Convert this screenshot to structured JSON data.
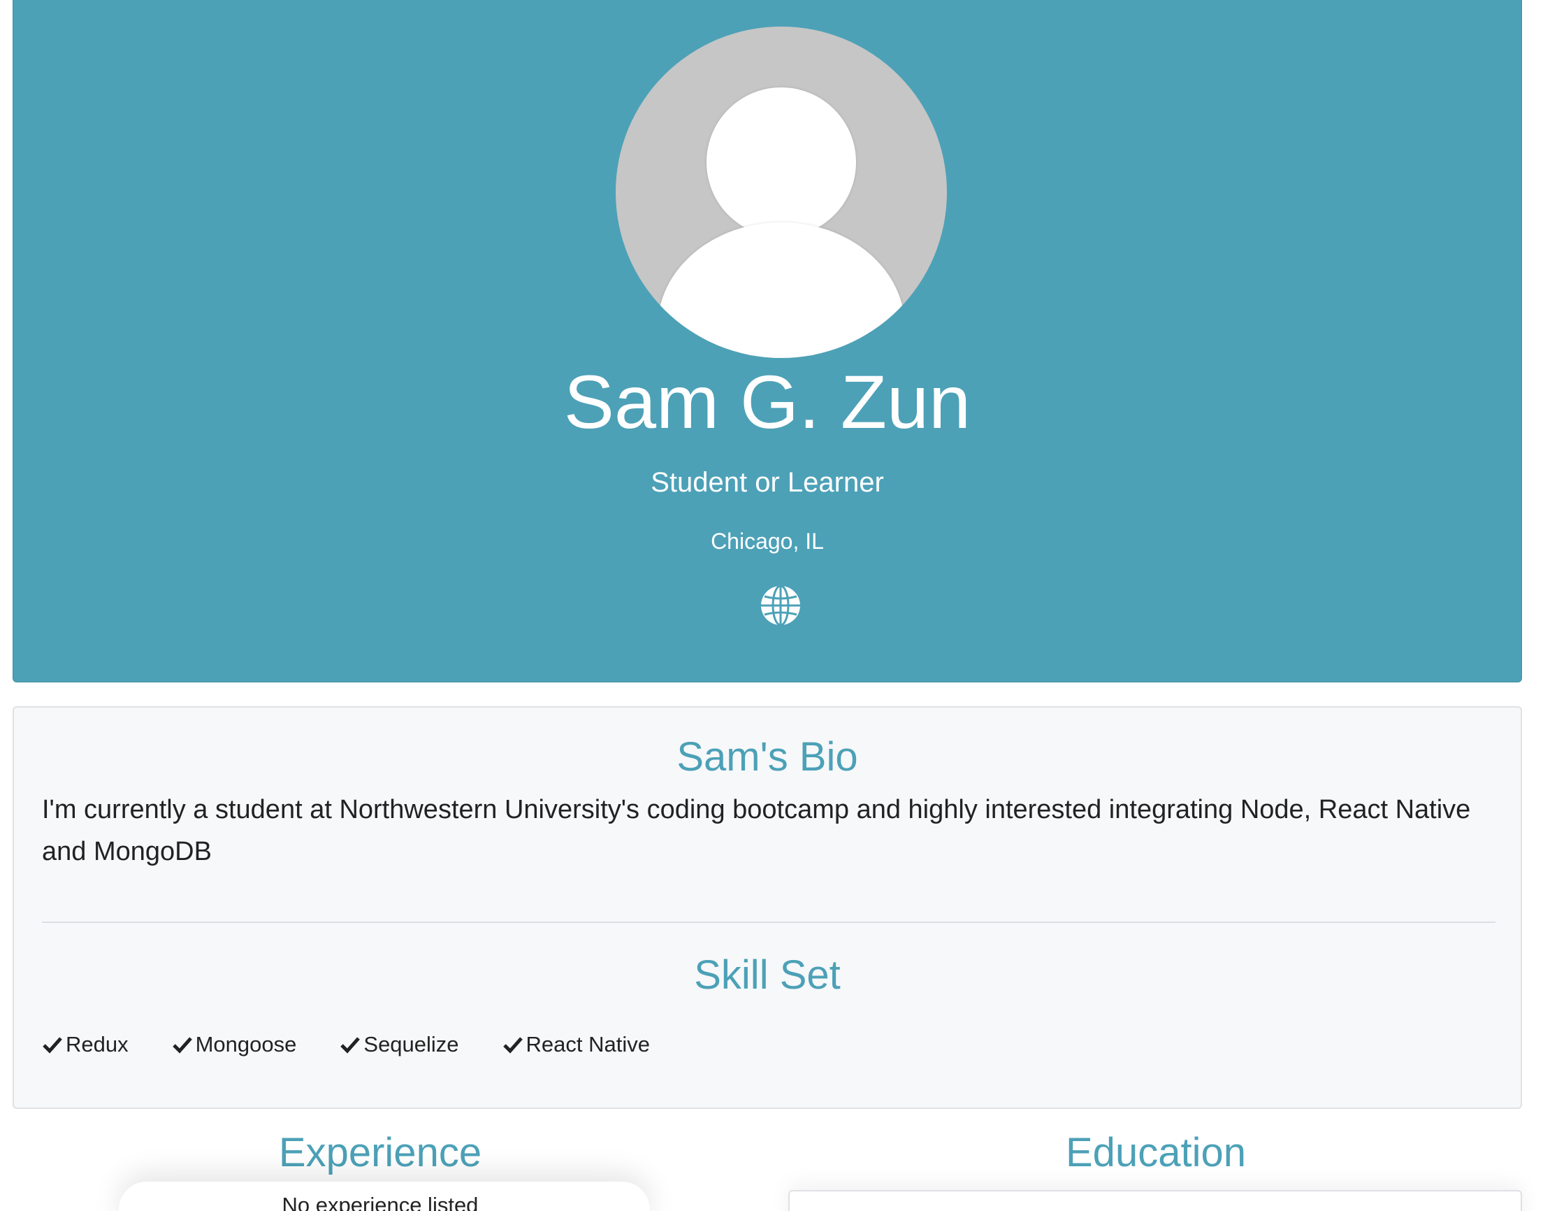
{
  "profile": {
    "name": "Sam G. Zun",
    "status": "Student or Learner",
    "location": "Chicago, IL",
    "website_icon": "globe-icon",
    "avatar_icon": "default-user-avatar",
    "header_color": "#4ca1b7"
  },
  "bio": {
    "title": "Sam's Bio",
    "text": "I'm currently a student at Northwestern University's coding bootcamp and highly interested integrating Node, React Native and MongoDB"
  },
  "skills": {
    "title": "Skill Set",
    "items": [
      "Redux",
      "Mongoose",
      "Sequelize",
      "React Native"
    ],
    "item_icon": "check-icon"
  },
  "experience": {
    "title": "Experience",
    "empty_text": "No experience listed"
  },
  "education": {
    "title": "Education"
  },
  "colors": {
    "accent": "#4ca1b7",
    "text": "#222222",
    "card_background": "#f7f8fa"
  }
}
